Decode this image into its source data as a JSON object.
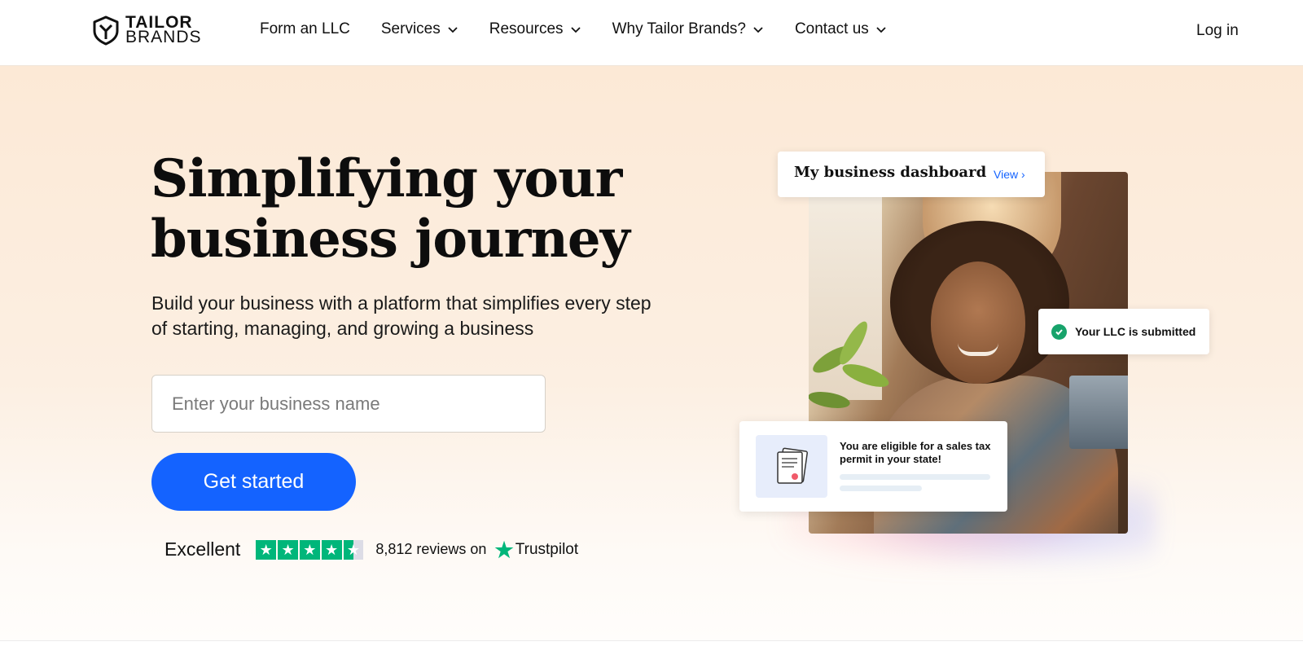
{
  "brand": {
    "line1": "TAILOR",
    "line2": "BRANDS",
    "icon": "tailor-brands-shield-logo"
  },
  "nav": {
    "items": [
      {
        "label": "Form an LLC",
        "has_dropdown": false
      },
      {
        "label": "Services",
        "has_dropdown": true
      },
      {
        "label": "Resources",
        "has_dropdown": true
      },
      {
        "label": "Why Tailor Brands?",
        "has_dropdown": true
      },
      {
        "label": "Contact us",
        "has_dropdown": true
      }
    ],
    "login": "Log in"
  },
  "hero": {
    "headline_line1": "Simplifying your",
    "headline_line2": "business journey",
    "subtext": "Build your business with a platform that simplifies every step of starting, managing, and growing a business",
    "input_placeholder": "Enter your business name",
    "input_value": "",
    "cta": "Get started"
  },
  "trust": {
    "rating_word": "Excellent",
    "stars": 4.5,
    "reviews_text": "8,812 reviews on",
    "provider": "Trustpilot"
  },
  "illustration": {
    "dashboard_title": "My business dashboard",
    "dashboard_link": "View",
    "llc_status": "Your LLC is submitted",
    "tax_message": "You are eligible for a sales tax permit in your state!"
  },
  "colors": {
    "primary": "#1463ff",
    "hero_bg_top": "#fce9d6",
    "success": "#17a36b",
    "trustpilot_green": "#00b67a"
  }
}
